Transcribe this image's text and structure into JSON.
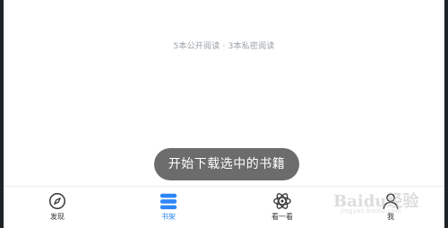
{
  "reading_summary": "5本公开阅读 · 3本私密阅读",
  "toast": "开始下载选中的书籍",
  "tabs": [
    {
      "label": "发现",
      "icon": "compass-icon",
      "active": false
    },
    {
      "label": "书架",
      "icon": "bookshelf-icon",
      "active": true
    },
    {
      "label": "看一看",
      "icon": "atom-icon",
      "active": false
    },
    {
      "label": "我",
      "icon": "person-icon",
      "active": false
    }
  ],
  "colors": {
    "active": "#2f86f6",
    "text": "#333333",
    "toast_bg": "#5f5f5f"
  },
  "watermark": {
    "brand": "Baidu经验",
    "url": "jingyan.baidu.com"
  }
}
